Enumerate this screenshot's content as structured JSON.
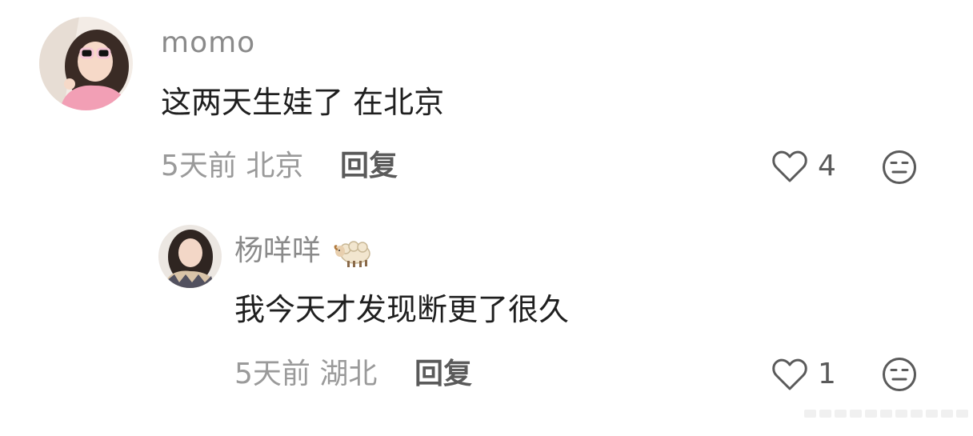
{
  "comments": [
    {
      "username": "momo",
      "content": "这两天生娃了 在北京",
      "meta": "5天前 北京",
      "reply_label": "回复",
      "like_count": "4"
    },
    {
      "username": "杨咩咩",
      "content": "我今天才发现断更了很久",
      "meta": "5天前 湖北",
      "reply_label": "回复",
      "like_count": "1"
    }
  ],
  "icons": {
    "like": "heart-outline-icon",
    "emoji": "expressionless-face-icon",
    "username_badge": "sheep-emoji"
  },
  "colors": {
    "username": "#8a8a8a",
    "meta": "#9a9a9a",
    "reply": "#5a5a5a",
    "content": "#1f1f1f"
  }
}
